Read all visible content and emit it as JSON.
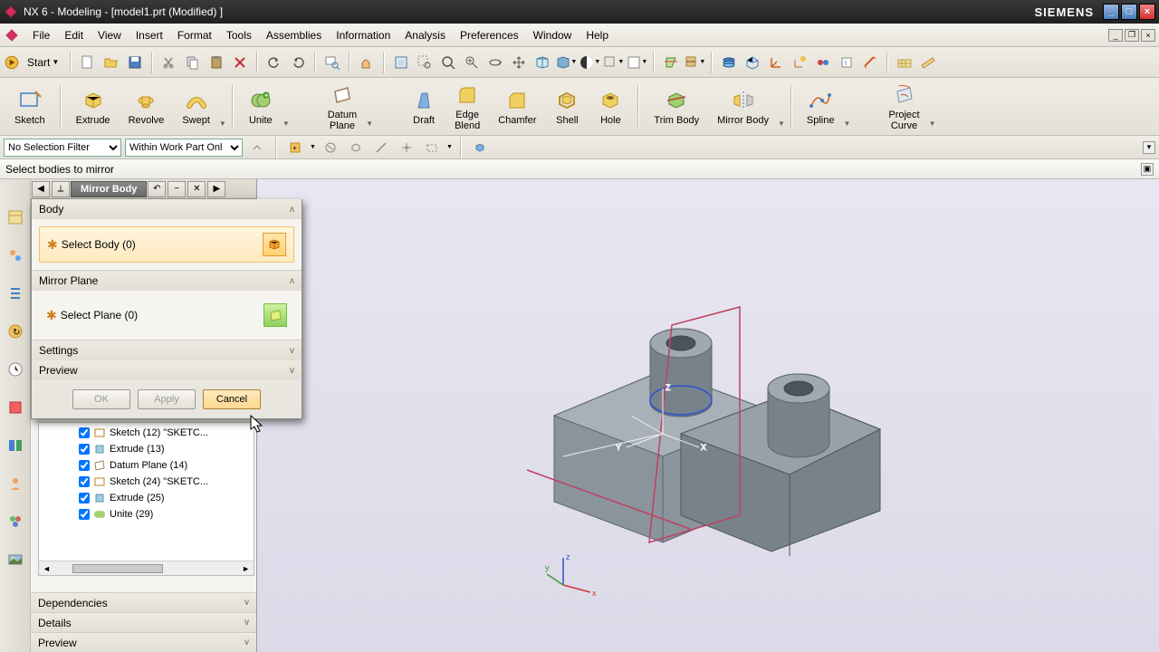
{
  "title": "NX 6 - Modeling - [model1.prt (Modified) ]",
  "brand": "SIEMENS",
  "menu": [
    "File",
    "Edit",
    "View",
    "Insert",
    "Format",
    "Tools",
    "Assemblies",
    "Information",
    "Analysis",
    "Preferences",
    "Window",
    "Help"
  ],
  "start": "Start",
  "ribbon": {
    "sketch": "Sketch",
    "extrude": "Extrude",
    "revolve": "Revolve",
    "swept": "Swept",
    "unite": "Unite",
    "datumplane": "Datum\nPlane",
    "draft": "Draft",
    "edgeblend": "Edge\nBlend",
    "chamfer": "Chamfer",
    "shell": "Shell",
    "hole": "Hole",
    "trimbody": "Trim Body",
    "mirrorbody": "Mirror Body",
    "spline": "Spline",
    "projectcurve": "Project\nCurve"
  },
  "selfilter": "No Selection Filter",
  "selscope": "Within Work Part Onl",
  "prompt": "Select bodies to mirror",
  "dialog": {
    "title": "Mirror Body",
    "body_section": "Body",
    "select_body": "Select Body (0)",
    "mirror_section": "Mirror Plane",
    "select_plane": "Select Plane (0)",
    "settings": "Settings",
    "preview": "Preview",
    "ok": "OK",
    "apply": "Apply",
    "cancel": "Cancel"
  },
  "tree": {
    "items": [
      "Sketch (12) \"SKETC...",
      "Extrude (13)",
      "Datum Plane (14)",
      "Sketch (24) \"SKETC...",
      "Extrude (25)",
      "Unite (29)"
    ]
  },
  "panels": {
    "dependencies": "Dependencies",
    "details": "Details",
    "preview": "Preview"
  }
}
